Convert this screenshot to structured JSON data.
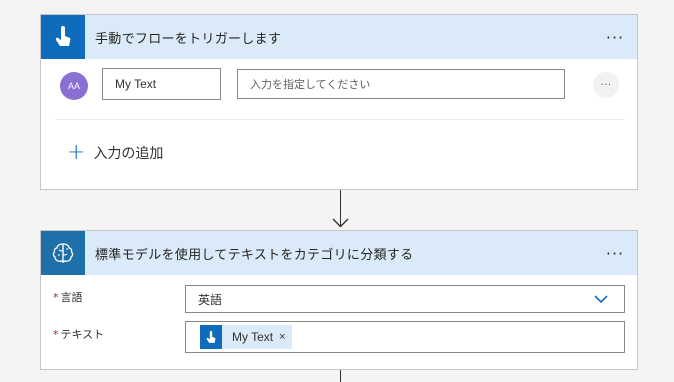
{
  "trigger": {
    "title": "手動でフローをトリガーします",
    "more": "···",
    "input_row": {
      "avatar_text": "AA",
      "name_value": "My Text",
      "value_placeholder": "入力を指定してください",
      "row_more": "···"
    },
    "add_input_label": "入力の追加",
    "icon": "hand-touch-icon",
    "header_color": "#dbeaf8",
    "icon_bg": "#0f6cbd"
  },
  "action": {
    "title": "標準モデルを使用してテキストをカテゴリに分類する",
    "more": "···",
    "icon": "brain-icon",
    "icon_bg": "#1f6fa8",
    "params": {
      "language_label": "言語",
      "language_value": "英語",
      "text_label": "テキスト",
      "text_token": "My Text",
      "token_remove": "×"
    }
  },
  "colors": {
    "accent": "#0f6cbd",
    "required": "#a4262c",
    "avatar": "#8b6fd2"
  }
}
